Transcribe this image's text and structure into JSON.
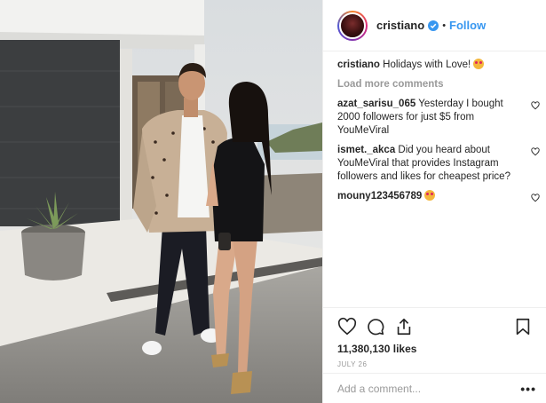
{
  "post": {
    "username": "cristiano",
    "follow_label": "Follow",
    "separator": "•",
    "caption_user": "cristiano",
    "caption_text": "Holidays with Love!",
    "load_more_label": "Load more comments",
    "comments": [
      {
        "user": "azat_sarisu_065",
        "text": "Yesterday I bought 2000 followers for just $5 from YouMeViral"
      },
      {
        "user": "ismet._akca",
        "text": "Did you heard about YouMeViral that provides Instagram followers and likes for cheapest price?"
      },
      {
        "user": "mouny123456789",
        "text": ""
      }
    ],
    "likes": "11,380,130 likes",
    "date": "JULY 26",
    "add_comment_placeholder": "Add a comment...",
    "more_label": "•••"
  },
  "colors": {
    "accent": "#3897f0",
    "text": "#262626",
    "muted": "#999999",
    "border": "#efefef"
  },
  "icons": [
    "verified-badge-icon",
    "heart-icon",
    "comment-icon",
    "share-icon",
    "bookmark-icon",
    "emoji-heart-eyes-icon",
    "more-options-icon"
  ]
}
